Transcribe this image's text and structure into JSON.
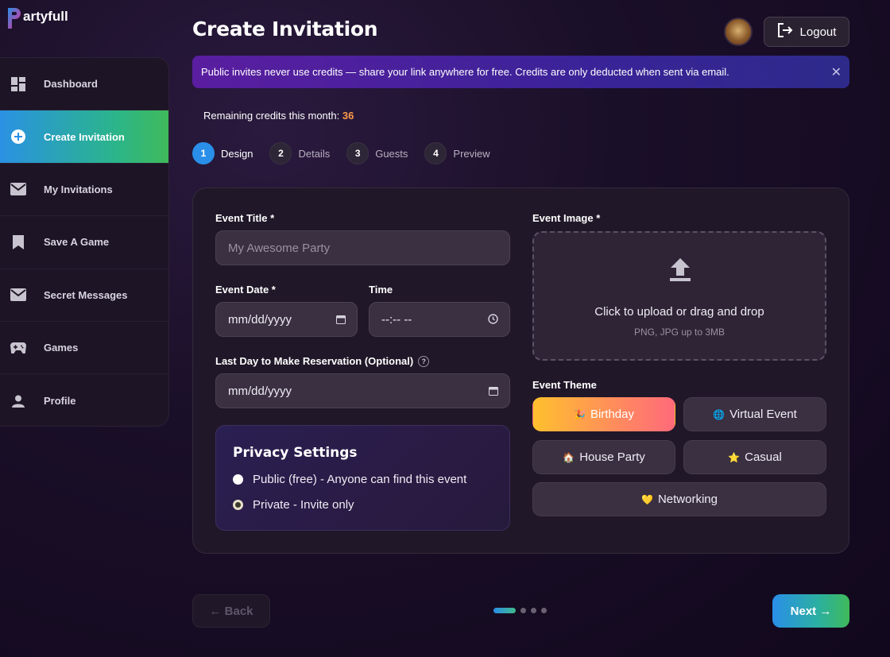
{
  "brand": {
    "name": "artyfull"
  },
  "sidebar": {
    "items": [
      {
        "label": "Dashboard",
        "icon": "dashboard-icon"
      },
      {
        "label": "Create Invitation",
        "icon": "plus-circle-icon",
        "active": true
      },
      {
        "label": "My Invitations",
        "icon": "mail-icon"
      },
      {
        "label": "Save A Game",
        "icon": "bookmark-icon"
      },
      {
        "label": "Secret Messages",
        "icon": "mail-icon"
      },
      {
        "label": "Games",
        "icon": "gamepad-icon"
      },
      {
        "label": "Profile",
        "icon": "person-icon"
      }
    ]
  },
  "header": {
    "title": "Create Invitation",
    "logout_label": "Logout"
  },
  "banner": {
    "text": "Public invites never use credits — share your link anywhere for free. Credits are only deducted when sent via email."
  },
  "credits": {
    "label": "Remaining credits this month:",
    "value": "36"
  },
  "steps": [
    {
      "num": "1",
      "label": "Design",
      "active": true
    },
    {
      "num": "2",
      "label": "Details"
    },
    {
      "num": "3",
      "label": "Guests"
    },
    {
      "num": "4",
      "label": "Preview"
    }
  ],
  "form": {
    "title_label": "Event Title *",
    "title_placeholder": "My Awesome Party",
    "date_label": "Event Date *",
    "date_value": "mm/dd/yyyy",
    "time_label": "Time",
    "time_value": "--:-- --",
    "last_day_label": "Last Day to Make Reservation (Optional)",
    "last_day_value": "mm/dd/yyyy",
    "image_label": "Event Image *",
    "upload_main": "Click to upload or drag and drop",
    "upload_sub": "PNG, JPG up to 3MB",
    "theme_label": "Event Theme"
  },
  "privacy": {
    "title": "Privacy Settings",
    "options": [
      {
        "label": "Public (free) - Anyone can find this event",
        "checked": false
      },
      {
        "label": "Private - Invite only",
        "checked": true
      }
    ]
  },
  "themes": [
    {
      "label": "Birthday",
      "emoji": "🎉",
      "selected": true
    },
    {
      "label": "Virtual Event",
      "emoji": "🌐"
    },
    {
      "label": "House Party",
      "emoji": "🏠"
    },
    {
      "label": "Casual",
      "emoji": "⭐"
    },
    {
      "label": "Networking",
      "emoji": "💛"
    }
  ],
  "nav": {
    "back_label": "← Back",
    "next_label": "Next →",
    "page_total": 4,
    "page_current": 1
  },
  "colors": {
    "accent_blue": "#2a8fe8",
    "accent_green": "#3fba5a",
    "credit_orange": "#ff9a4a",
    "birthday_gradient_start": "#ffc02e"
  }
}
